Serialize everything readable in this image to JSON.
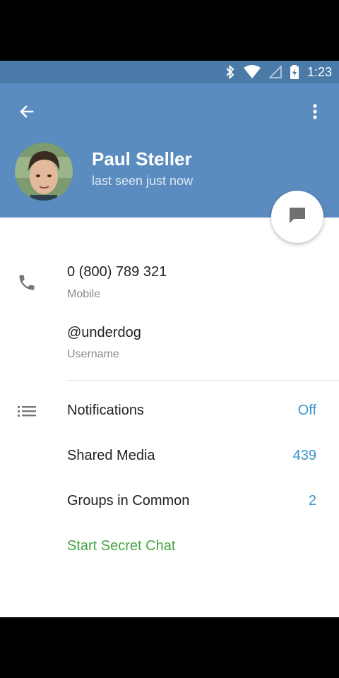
{
  "status_bar": {
    "time": "1:23"
  },
  "colors": {
    "header": "#5b8cbf",
    "status_bar": "#4a7aa8",
    "accent_value": "#3a95cc",
    "secret_chat": "#44a53f"
  },
  "profile": {
    "name": "Paul Steller",
    "status": "last seen just now"
  },
  "info": {
    "phone": {
      "value": "0 (800) 789 321",
      "label": "Mobile"
    },
    "username": {
      "value": "@underdog",
      "label": "Username"
    }
  },
  "menu": {
    "notifications": {
      "label": "Notifications",
      "value": "Off"
    },
    "shared_media": {
      "label": "Shared Media",
      "value": "439"
    },
    "groups_in_common": {
      "label": "Groups in Common",
      "value": "2"
    },
    "secret_chat": {
      "label": "Start Secret Chat"
    }
  },
  "icons": [
    "bluetooth-icon",
    "wifi-icon",
    "signal-icon",
    "battery-icon",
    "back-arrow-icon",
    "more-vert-icon",
    "message-icon",
    "phone-icon",
    "list-icon"
  ]
}
